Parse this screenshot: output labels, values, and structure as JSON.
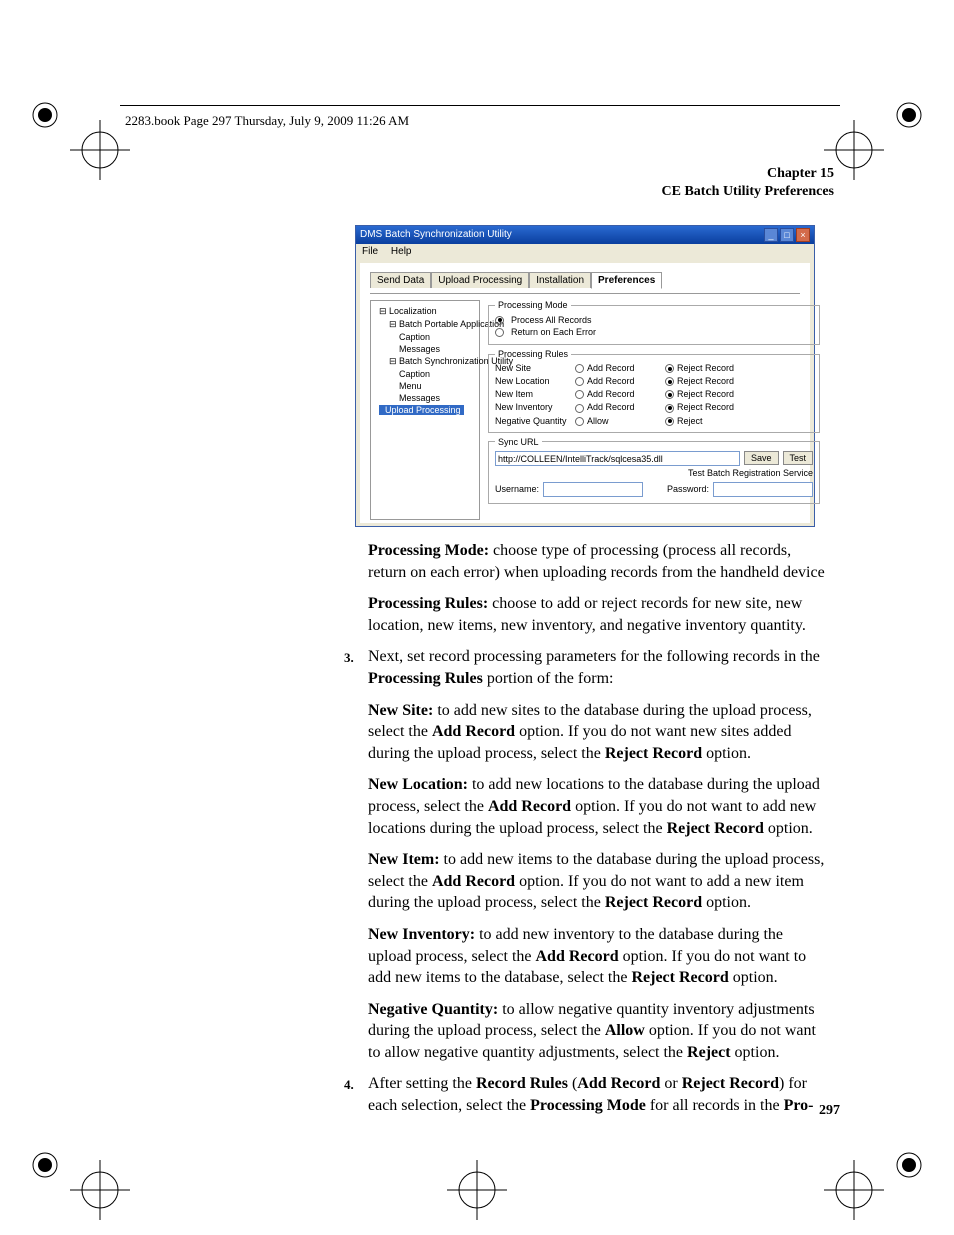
{
  "crop_header": "2283.book  Page 297  Thursday, July 9, 2009  11:26 AM",
  "running_head": {
    "chapter": "Chapter 15",
    "section": "CE Batch Utility Preferences"
  },
  "page_number": "297",
  "app": {
    "title": "DMS Batch Synchronization Utility",
    "win_btn_min": "_",
    "win_btn_max": "□",
    "win_btn_close": "×",
    "menu": {
      "file": "File",
      "help": "Help"
    },
    "tabs": {
      "send_data": "Send Data",
      "upload_processing": "Upload Processing",
      "installation": "Installation",
      "preferences": "Preferences"
    },
    "tree": {
      "localization": "Localization",
      "bpa": "Batch Portable Application",
      "caption": "Caption",
      "messages": "Messages",
      "bsu": "Batch Synchronization Utility",
      "menu": "Menu",
      "upload_processing": "Upload Processing"
    },
    "groups": {
      "processing_mode": "Processing Mode",
      "processing_rules": "Processing Rules",
      "sync_url": "Sync URL"
    },
    "mode": {
      "process_all": "Process All Records",
      "return_err": "Return on Each Error"
    },
    "rules": {
      "new_site": "New Site",
      "new_location": "New Location",
      "new_item": "New Item",
      "new_inventory": "New Inventory",
      "negative_qty": "Negative Quantity",
      "add_record": "Add Record",
      "reject_record": "Reject Record",
      "allow": "Allow",
      "reject": "Reject"
    },
    "sync": {
      "url_value": "http://COLLEEN/IntelliTrack/sqlcesa35.dll",
      "save": "Save",
      "test": "Test",
      "test_label": "Test Batch Registration Service",
      "username_label": "Username:",
      "password_label": "Password:",
      "username_value": "",
      "password_value": ""
    }
  },
  "body": {
    "p1a": "Processing Mode:",
    "p1b": " choose type of processing (process all records, return on each error) when uploading records from the handheld device",
    "p2a": "Processing Rules:",
    "p2b": " choose to add or reject records for new site, new location, new items, new inventory, and negative inventory quantity.",
    "n3": "3.",
    "p3a": "Next, set record processing parameters for the following records in the ",
    "p3b": "Processing Rules",
    "p3c": " portion of the form:",
    "p4a": "New Site:",
    "p4b": " to add new sites to the database during the upload process, select the ",
    "p4c": "Add Record",
    "p4d": " option. If you do not want new sites added during the upload process, select the ",
    "p4e": "Reject Record",
    "p4f": " option.",
    "p5a": "New Location:",
    "p5b": " to add new locations to the database during the upload process, select the ",
    "p5c": "Add Record",
    "p5d": " option. If you do not want to add new locations during the upload process, select the ",
    "p5e": "Reject Record",
    "p5f": " option.",
    "p6a": "New Item:",
    "p6b": " to add new items to the database during the upload process, select the ",
    "p6c": "Add Record",
    "p6d": " option. If you do not want to add a new item during the upload process, select the ",
    "p6e": "Reject Record",
    "p6f": " option.",
    "p7a": "New Inventory:",
    "p7b": " to add new inventory to the database during the upload process, select the ",
    "p7c": "Add Record",
    "p7d": " option. If you do not want to add new items to the database, select the ",
    "p7e": "Reject Record",
    "p7f": " option.",
    "p8a": "Negative Quantity:",
    "p8b": " to allow negative quantity inventory adjustments during the upload process, select the ",
    "p8c": "Allow",
    "p8d": " option. If you do not want to allow negative quantity adjustments, select the ",
    "p8e": "Reject",
    "p8f": " option.",
    "n4": "4.",
    "p9a": "After setting the ",
    "p9b": "Record Rules",
    "p9c": " (",
    "p9d": "Add Record",
    "p9e": " or ",
    "p9f": "Reject Record",
    "p9g": ") for each selection, select the ",
    "p9h": "Processing Mode",
    "p9i": " for all records in the ",
    "p9j": "Pro-"
  }
}
